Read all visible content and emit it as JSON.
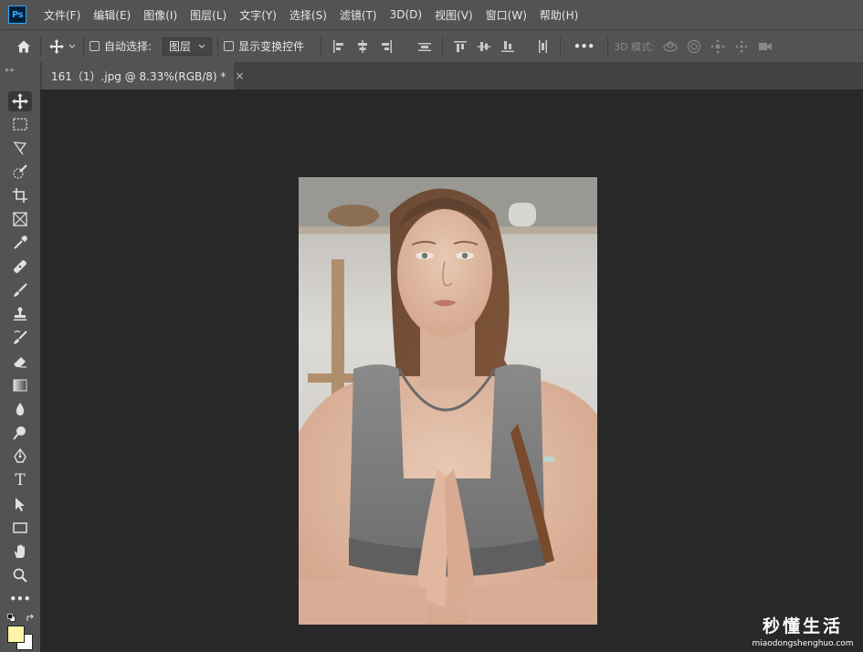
{
  "app": {
    "logo_text": "Ps",
    "menu": [
      "文件(F)",
      "编辑(E)",
      "图像(I)",
      "图层(L)",
      "文字(Y)",
      "选择(S)",
      "滤镜(T)",
      "3D(D)",
      "视图(V)",
      "窗口(W)",
      "帮助(H)"
    ]
  },
  "options_bar": {
    "auto_select_label": "自动选择:",
    "auto_select_checked": false,
    "layer_select_value": "图层",
    "show_transform_label": "显示变换控件",
    "show_transform_checked": false,
    "more_label": "•••",
    "mode_3d_label": "3D 模式:"
  },
  "document_tab": {
    "title": "161（1）.jpg @ 8.33%(RGB/8) *",
    "close_glyph": "×"
  },
  "toolbar": {
    "tools": [
      "move-tool",
      "rectangular-marquee-tool",
      "lasso-tool",
      "quick-selection-tool",
      "crop-tool",
      "frame-tool",
      "eyedropper-tool",
      "healing-brush-tool",
      "brush-tool",
      "clone-stamp-tool",
      "history-brush-tool",
      "eraser-tool",
      "gradient-tool",
      "blur-tool",
      "dodge-tool",
      "pen-tool",
      "type-tool",
      "path-selection-tool",
      "rectangle-tool",
      "hand-tool",
      "zoom-tool",
      "edit-toolbar"
    ],
    "type_tool_glyph": "T",
    "foreground_color": "#fdf5a6",
    "background_color": "#ffffff"
  },
  "watermark": {
    "title": "秒懂生活",
    "url": "miaodongshenghuo.com"
  }
}
